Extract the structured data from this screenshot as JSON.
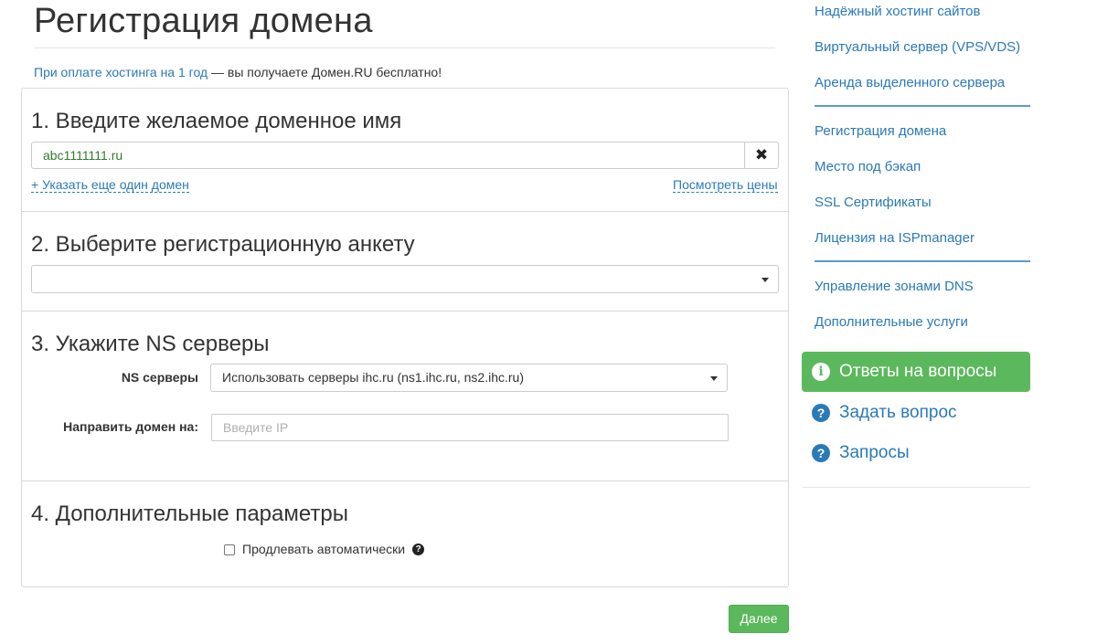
{
  "header": {
    "title": "Регистрация домена"
  },
  "promo": {
    "link": "При оплате хостинга на 1 год",
    "text": " — вы получаете Домен.RU бесплатно!"
  },
  "form": {
    "step1": {
      "title": "1. Введите желаемое доменное имя",
      "domain_value": "abc1111111.ru",
      "add_domain_link": "+ Указать еще один домен",
      "prices_link": "Посмотреть цены"
    },
    "step2": {
      "title": "2. Выберите регистрационную анкету",
      "selected": ""
    },
    "step3": {
      "title": "3. Укажите NS серверы",
      "ns_label": "NS серверы",
      "ns_selected": "Использовать серверы ihc.ru (ns1.ihc.ru, ns2.ihc.ru)",
      "ip_label": "Направить домен на:",
      "ip_placeholder": "Введите IP"
    },
    "step4": {
      "title": "4. Дополнительные параметры",
      "autorenew_label": "Продлевать автоматически",
      "autorenew_checked": false
    },
    "next_button": "Далее"
  },
  "sidebar": {
    "group1": [
      "Надёжный хостинг сайтов",
      "Виртуальный сервер (VPS/VDS)",
      "Аренда выделенного сервера"
    ],
    "group2": [
      "Регистрация домена",
      "Место под бэкап",
      "SSL Сертификаты",
      "Лицензия на ISPmanager"
    ],
    "group3": [
      "Управление зонами DNS",
      "Дополнительные услуги"
    ],
    "faq_button": "Ответы на вопросы",
    "ask_question": "Задать вопрос",
    "requests": "Запросы"
  },
  "colors": {
    "link": "#2a7ab8",
    "success": "#5cb85c",
    "domain_text": "#2f7d2a"
  }
}
